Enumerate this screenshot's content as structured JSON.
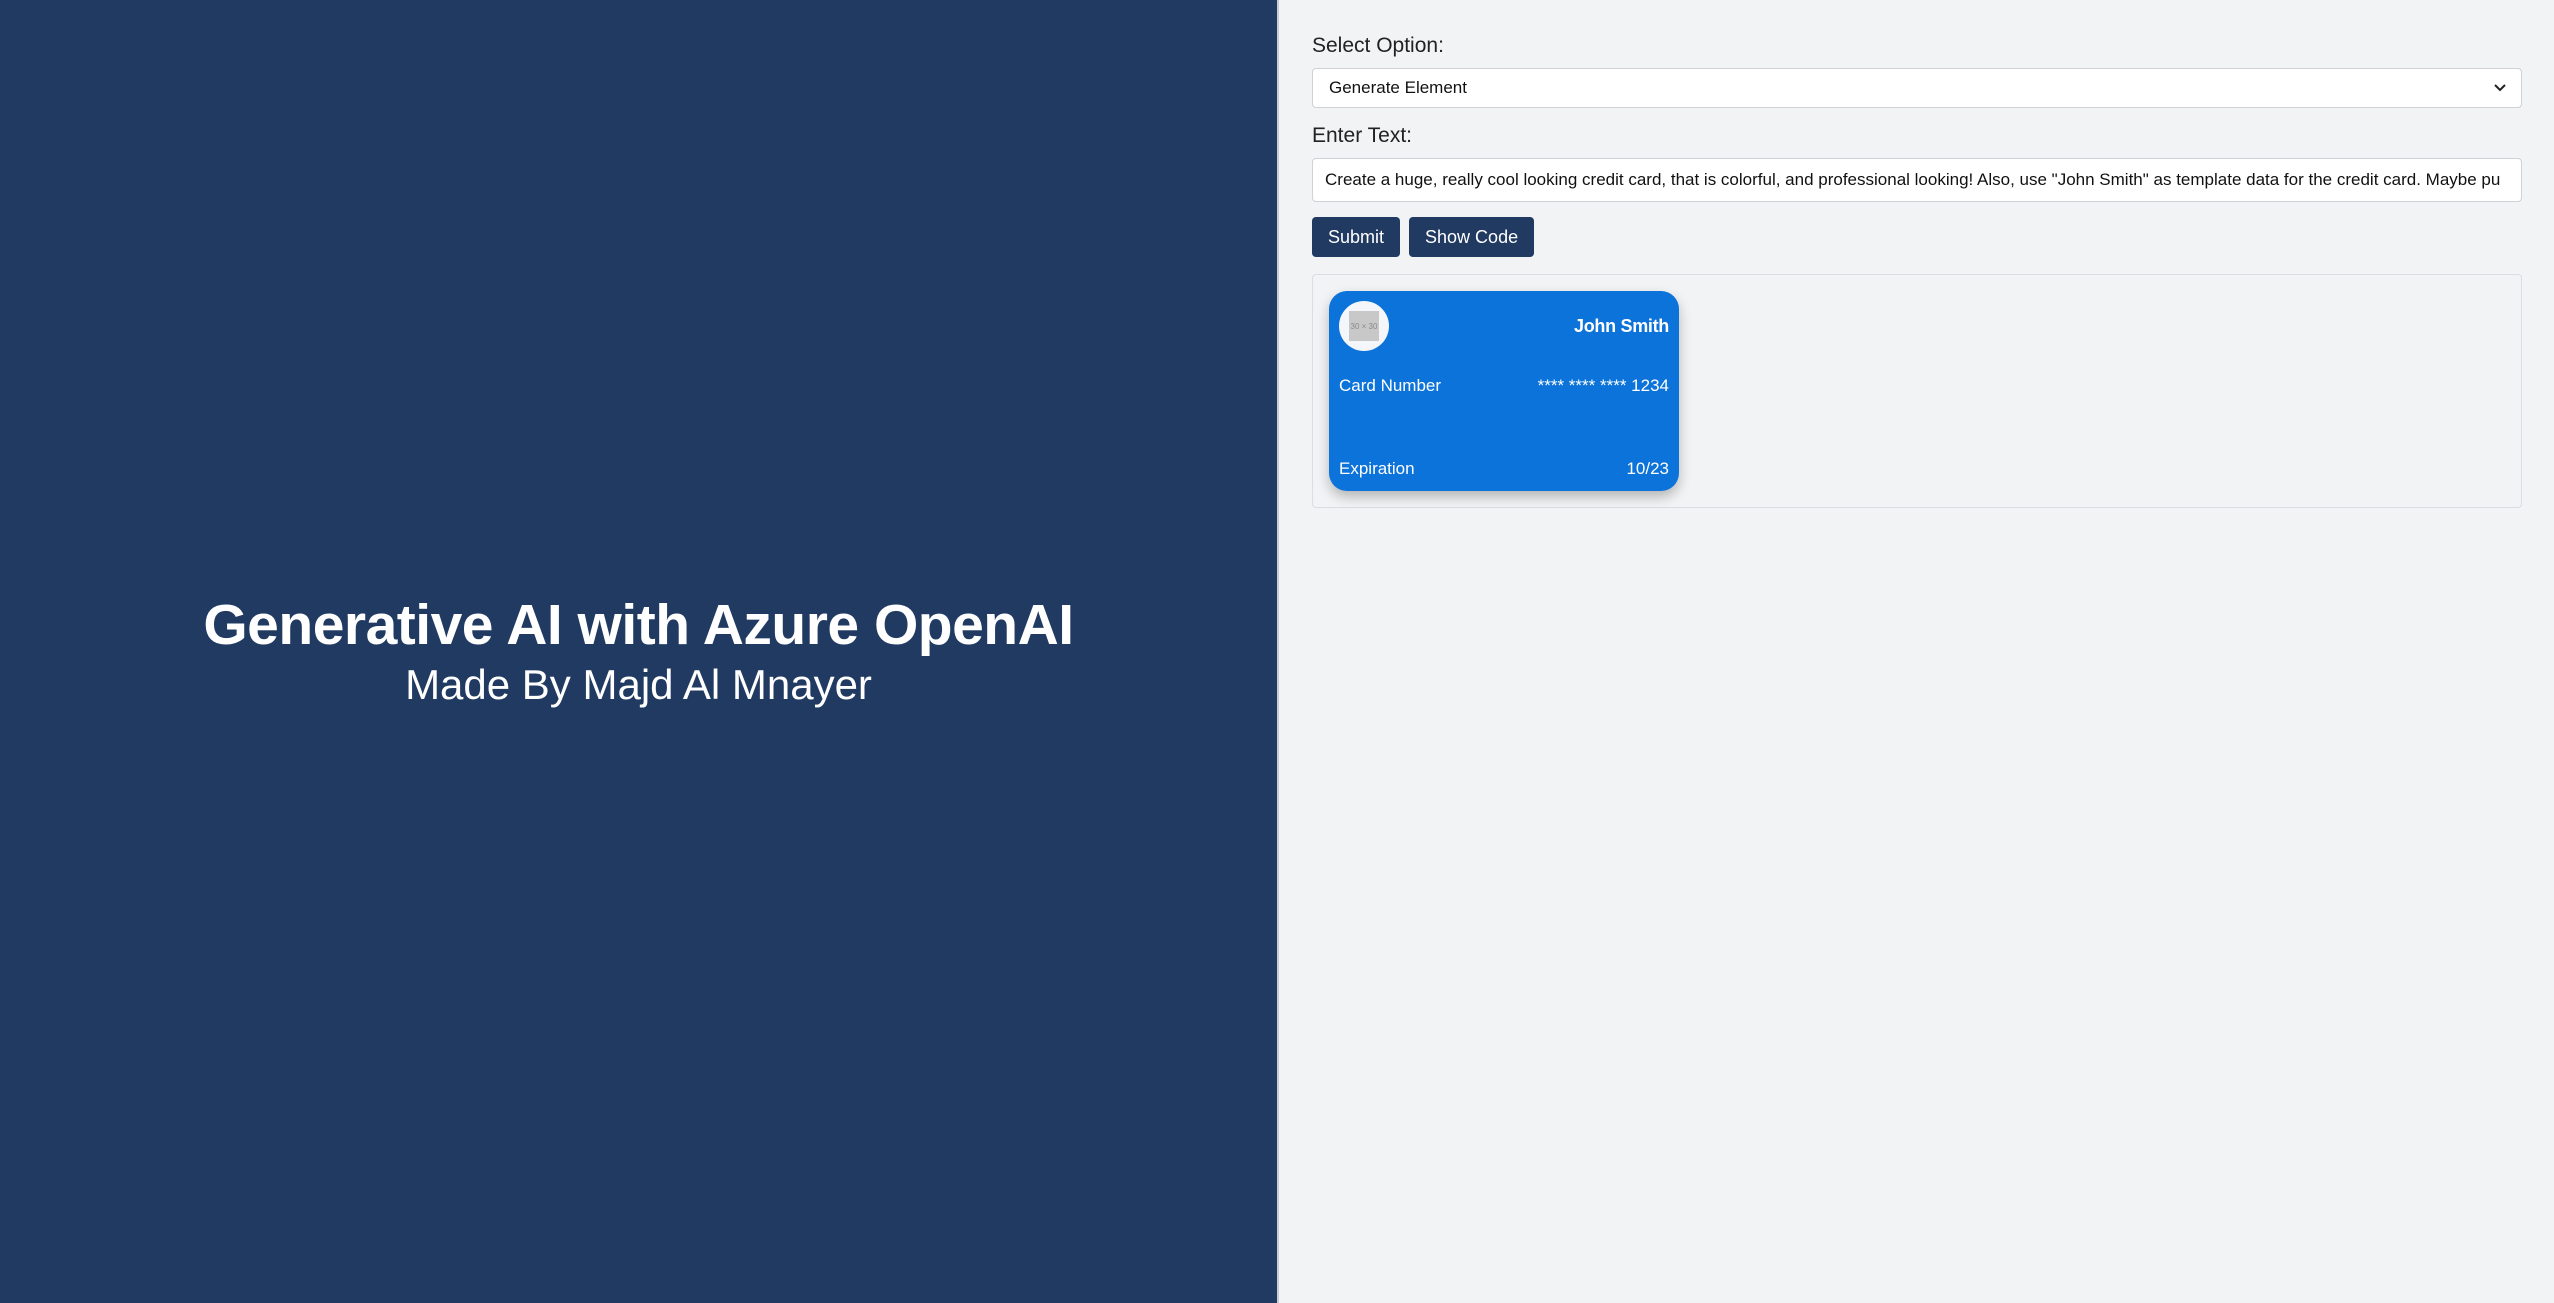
{
  "hero": {
    "title": "Generative AI with Azure OpenAI",
    "subtitle": "Made By Majd Al Mnayer"
  },
  "form": {
    "select_label": "Select Option:",
    "select_value": "Generate Element",
    "text_label": "Enter Text:",
    "text_value": "Create a huge, really cool looking credit card, that is colorful, and professional looking! Also, use \"John Smith\" as template data for the credit card. Maybe pu",
    "submit_label": "Submit",
    "show_code_label": "Show Code"
  },
  "card": {
    "logo_placeholder": "30 × 30",
    "holder_name": "John Smith",
    "number_label": "Card Number",
    "number_value": "**** **** **** 1234",
    "expiration_label": "Expiration",
    "expiration_value": "10/23"
  },
  "colors": {
    "left_panel_bg": "#213a62",
    "right_panel_bg": "#f2f3f5",
    "button_bg": "#213a62",
    "card_bg": "#0b73d9"
  },
  "icons": {
    "select_chevron": "chevron-down-icon",
    "card_logo": "image-placeholder-icon"
  }
}
